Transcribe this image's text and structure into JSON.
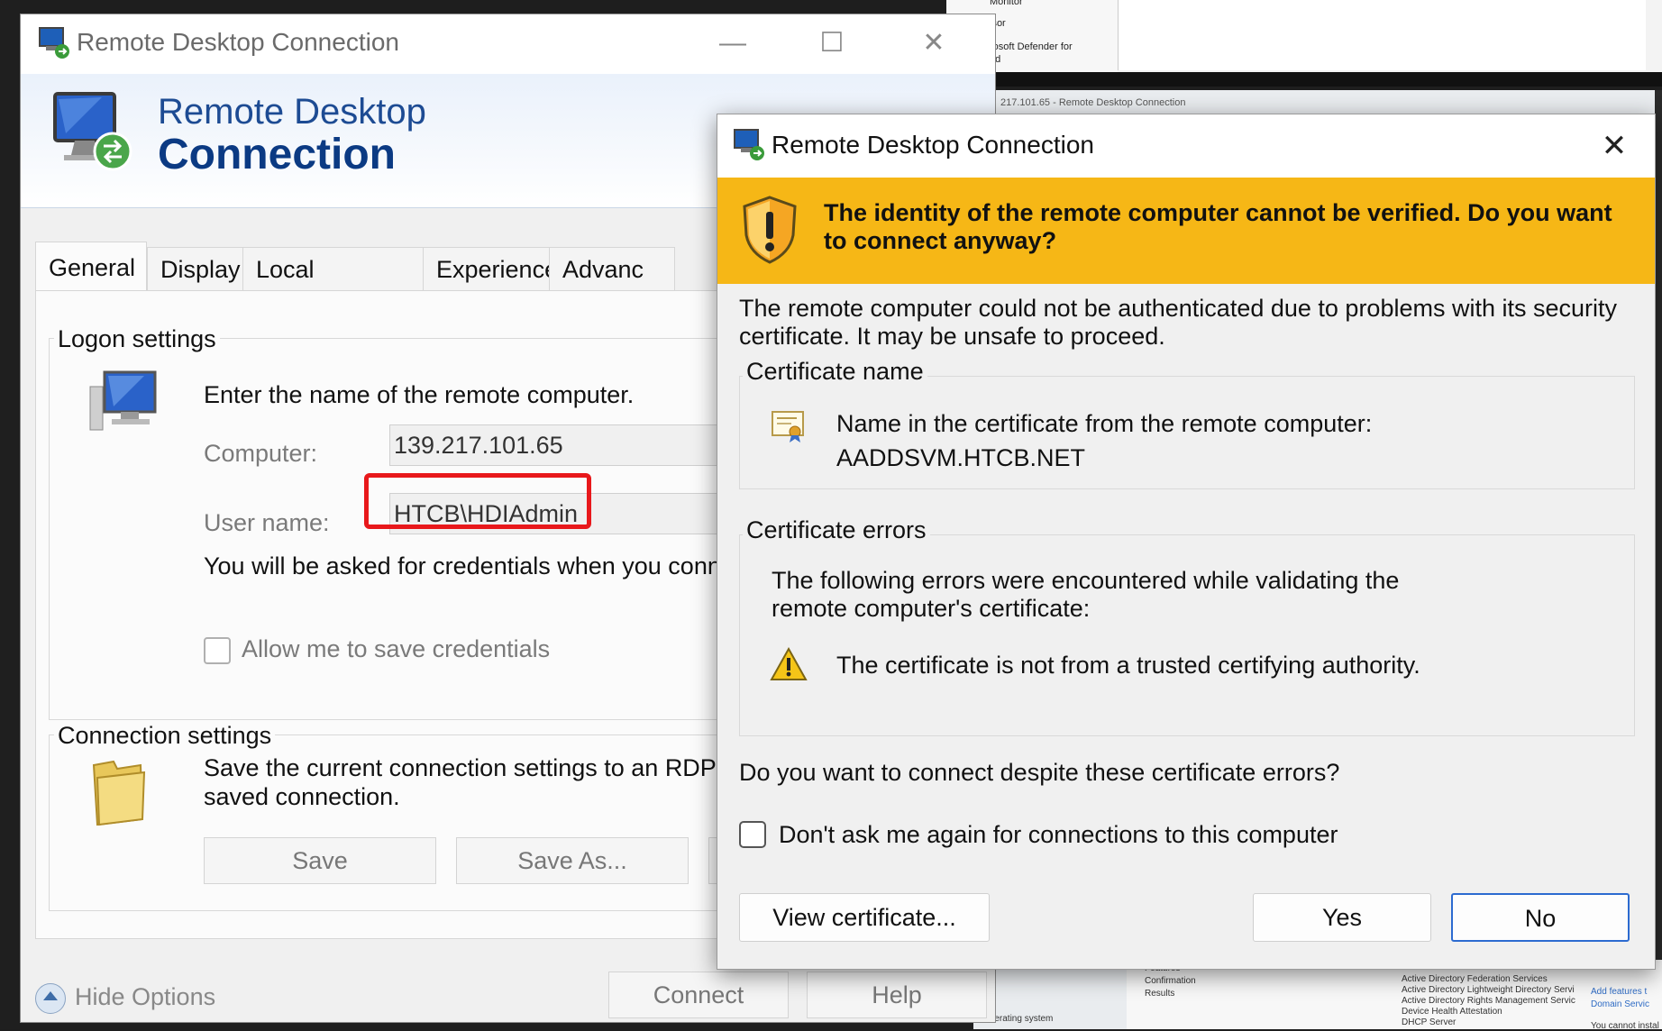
{
  "background": {
    "nav_items": [
      "Monitor",
      "isor",
      "rosoft Defender for",
      "ud"
    ],
    "window2_title": "217.101.65 - Remote Desktop Connection",
    "bottom_list": [
      "Active Directory Federation Services",
      "Active Directory Lightweight Directory Servi",
      "Active Directory Rights Management Servic",
      "Device Health Attestation",
      "DHCP Server"
    ],
    "bottom_side": [
      "Features",
      "Confirmation",
      "Results",
      "Operating system"
    ],
    "bottom_link": "Add features t",
    "bottom_link2": "Domain Servic",
    "bottom_note": "You cannot instal"
  },
  "main_window": {
    "title": "Remote Desktop Connection",
    "banner_line1": "Remote Desktop",
    "banner_line2": "Connection",
    "tabs": [
      "General",
      "Display",
      "Local Resources",
      "Experience",
      "Advanc"
    ],
    "logon": {
      "group_label": "Logon settings",
      "instruction": "Enter the name of the remote computer.",
      "computer_label": "Computer:",
      "computer_value": "139.217.101.65",
      "username_label": "User name:",
      "username_value": "HTCB\\HDIAdmin",
      "cred_note": "You will be asked for credentials when you conn",
      "allow_save_label": "Allow me to save credentials"
    },
    "connection": {
      "group_label": "Connection settings",
      "desc_line1": "Save the current connection settings to an RDP",
      "desc_line2": "saved connection.",
      "save_button": "Save",
      "save_as_button": "Save As..."
    },
    "hide_options": "Hide Options",
    "connect_button": "Connect",
    "help_button": "Help"
  },
  "dialog": {
    "title": "Remote Desktop Connection",
    "warning_heading": "The identity of the remote computer cannot be verified. Do you want to connect anyway?",
    "body_text": "The remote computer could not be authenticated due to problems with its security certificate. It may be unsafe to proceed.",
    "cert_name_group": "Certificate name",
    "cert_name_intro": "Name in the certificate from the remote computer:",
    "cert_name_value": "AADDSVM.HTCB.NET",
    "cert_errors_group": "Certificate errors",
    "cert_errors_intro": "The following errors were encountered while validating the remote computer's certificate:",
    "cert_error_item": "The certificate is not from a trusted certifying authority.",
    "question": "Do you want to connect despite these certificate errors?",
    "dont_ask_label": "Don't ask me again for connections to this computer",
    "view_cert_button": "View certificate...",
    "yes_button": "Yes",
    "no_button": "No"
  },
  "colors": {
    "warning_band": "#f6b716",
    "highlight_box": "#e8181b",
    "banner_text": "#0b3a83"
  }
}
